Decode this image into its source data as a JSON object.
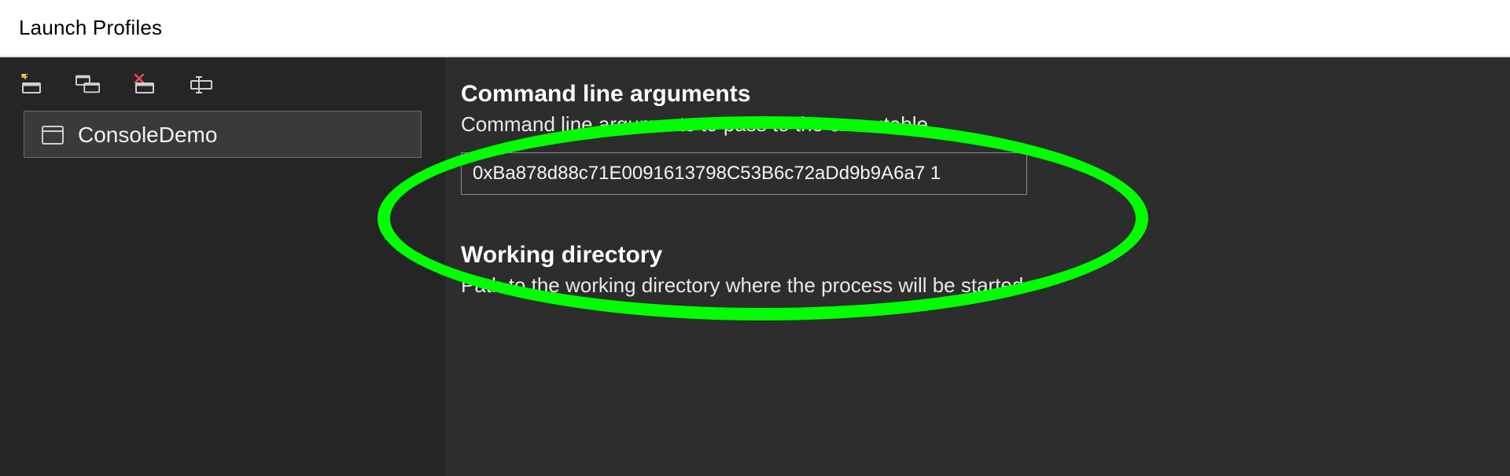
{
  "window": {
    "title": "Launch Profiles"
  },
  "sidebar": {
    "profiles": [
      {
        "label": "ConsoleDemo"
      }
    ]
  },
  "fields": {
    "cli": {
      "title": "Command line arguments",
      "desc": "Command line arguments to pass to the executable.",
      "value": "0xBa878d88c71E0091613798C53B6c72aDd9b9A6a7 1"
    },
    "wd": {
      "title": "Working directory",
      "desc": "Path to the working directory where the process will be started."
    }
  },
  "icons": {
    "new": "new-profile",
    "duplicate": "duplicate-profile",
    "delete": "delete-profile",
    "rename": "rename-profile"
  }
}
